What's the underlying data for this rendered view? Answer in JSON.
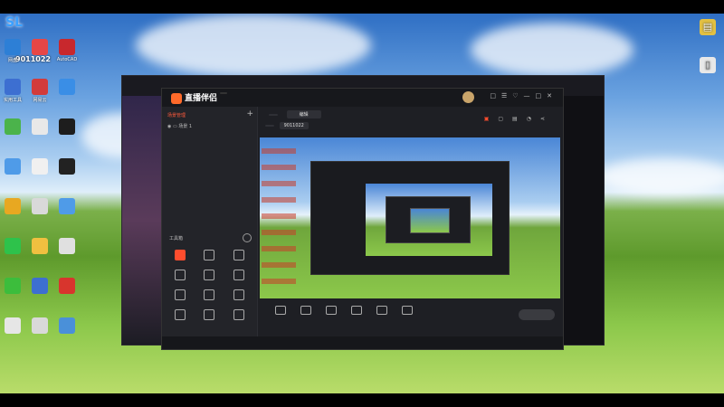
{
  "desktop": {
    "brand_badge": "SL",
    "badge_number": "9011022",
    "left_icons": [
      {
        "label": "网盘",
        "icon": "disk-icon",
        "color": "#2d7fd6"
      },
      {
        "label": "",
        "icon": "app-icon",
        "color": "#e64646"
      },
      {
        "label": "AutoCAD",
        "icon": "autocad-icon",
        "color": "#c8282d"
      },
      {
        "label": "实用工具",
        "icon": "tool-icon",
        "color": "#3d6fd1"
      },
      {
        "label": "网易云",
        "icon": "music-icon",
        "color": "#d23b3b"
      },
      {
        "label": "",
        "icon": "computer-icon",
        "color": "#3a8ee6"
      },
      {
        "label": "",
        "icon": "plus-icon",
        "color": "#4bb34b"
      },
      {
        "label": "",
        "icon": "doc-icon",
        "color": "#e8e8e8"
      },
      {
        "label": "",
        "icon": "qq-icon",
        "color": "#1d1d1d"
      },
      {
        "label": "",
        "icon": "folder-icon",
        "color": "#4f9be8"
      },
      {
        "label": "",
        "icon": "file-icon",
        "color": "#f0f0f0"
      },
      {
        "label": "",
        "icon": "media-icon",
        "color": "#222"
      },
      {
        "label": "",
        "icon": "chrome-icon",
        "color": "#e8a821"
      },
      {
        "label": "",
        "icon": "music2-icon",
        "color": "#d9d9d9"
      },
      {
        "label": "",
        "icon": "folder2-icon",
        "color": "#4f9be8"
      },
      {
        "label": "",
        "icon": "wechat-icon",
        "color": "#2ec24b"
      },
      {
        "label": "",
        "icon": "folder3-icon",
        "color": "#f0c040"
      },
      {
        "label": "",
        "icon": "folder4-icon",
        "color": "#e0e0e0"
      },
      {
        "label": "",
        "icon": "chat-icon",
        "color": "#3cbd3c"
      },
      {
        "label": "",
        "icon": "doc2-icon",
        "color": "#3d6fd1"
      },
      {
        "label": "",
        "icon": "star-icon",
        "color": "#d8352d"
      },
      {
        "label": "",
        "icon": "file2-icon",
        "color": "#e6e6e6"
      },
      {
        "label": "",
        "icon": "pdf-icon",
        "color": "#d9d9d9"
      },
      {
        "label": "",
        "icon": "net-icon",
        "color": "#4a90d9"
      }
    ],
    "right_icons": [
      {
        "label": "",
        "icon": "folder-icon",
        "color": "#e2c043"
      },
      {
        "label": "",
        "icon": "file-icon",
        "color": "#e8e8e8"
      }
    ]
  },
  "app": {
    "title": "直播伴侣",
    "version": "",
    "window_controls": [
      "□",
      "☰",
      "♡",
      "—",
      "□",
      "✕"
    ],
    "left_tabs": [
      "场景管理",
      "",
      ""
    ],
    "scene_item": "场景 1",
    "tools_header": "工具箱",
    "tools": [
      {
        "label": "",
        "hot": true,
        "icon": "live-icon"
      },
      {
        "label": "",
        "hot": false,
        "icon": "user-icon"
      },
      {
        "label": "",
        "hot": false,
        "icon": "settings-icon"
      },
      {
        "label": "",
        "hot": false,
        "icon": "gift-icon"
      },
      {
        "label": "",
        "hot": false,
        "icon": "bag-icon"
      },
      {
        "label": "",
        "hot": false,
        "icon": "chart-icon"
      },
      {
        "label": "",
        "hot": false,
        "icon": "shield-icon"
      },
      {
        "label": "",
        "hot": false,
        "icon": "fire-icon"
      },
      {
        "label": "",
        "hot": false,
        "icon": "calendar-icon"
      },
      {
        "label": "",
        "hot": false,
        "icon": "triangle-icon"
      },
      {
        "label": "",
        "hot": false,
        "icon": "download-icon"
      },
      {
        "label": "",
        "hot": false,
        "icon": "glasses-icon"
      }
    ],
    "info": {
      "line1": "",
      "category": "",
      "edit_label": "编辑",
      "line2_left": "",
      "room_id": "9011022"
    },
    "bottom_buttons": [
      {
        "label": "",
        "icon": "screen-icon"
      },
      {
        "label": "",
        "icon": "camera-icon"
      },
      {
        "label": "",
        "icon": "phone-icon"
      },
      {
        "label": "",
        "icon": "window-icon"
      },
      {
        "label": "",
        "icon": "mic-icon"
      },
      {
        "label": "",
        "icon": "speaker-icon"
      }
    ],
    "go_live_label": "",
    "status_tip": "",
    "status_stats": ""
  }
}
